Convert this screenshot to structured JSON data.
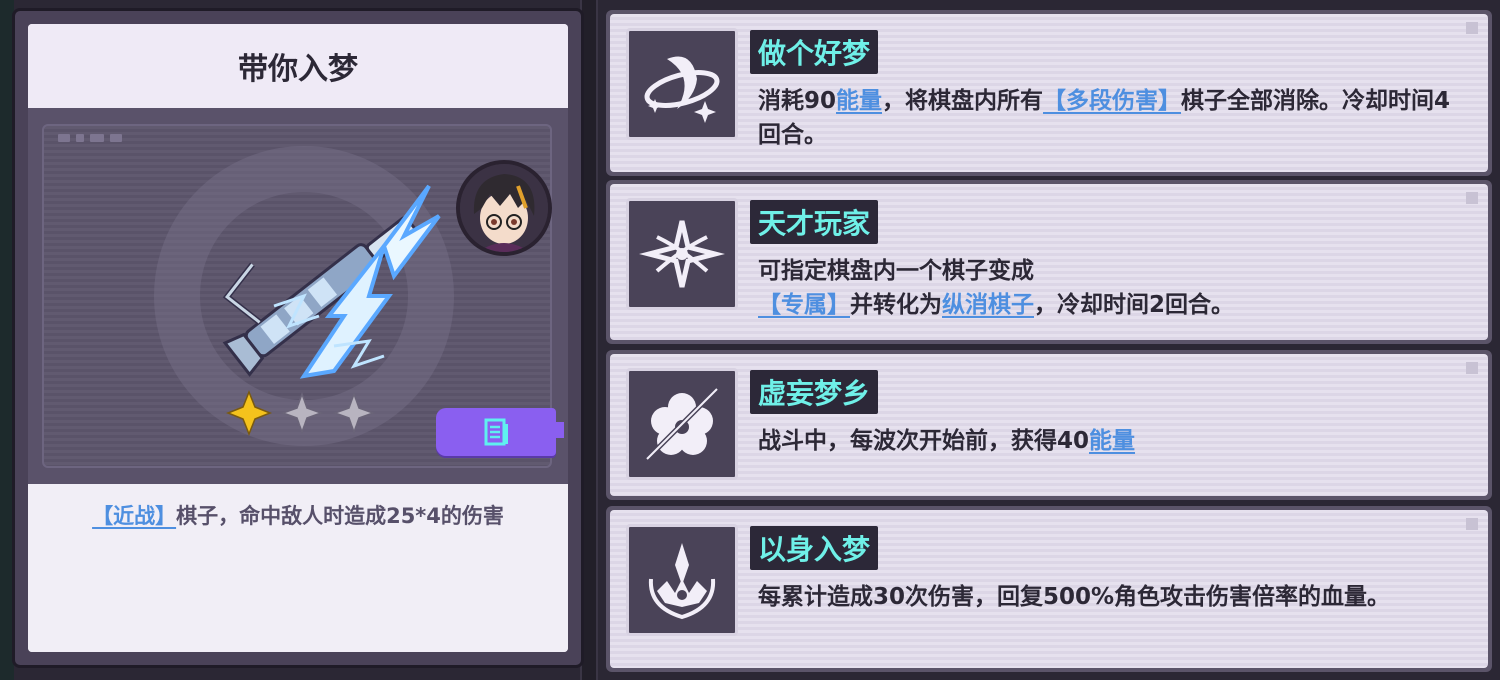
{
  "card": {
    "title": "带你入梦",
    "stars_filled": 1,
    "stars_total": 3,
    "desc": {
      "keyword": "【近战】",
      "text": "棋子，命中敌人时造成25*4的伤害"
    }
  },
  "skills": [
    {
      "name": "做个好梦",
      "icon": "ring-slash-icon",
      "desc": [
        {
          "t": "消耗90"
        },
        {
          "t": "能量",
          "kw": true
        },
        {
          "t": "，将棋盘内所有"
        },
        {
          "t": "【多段伤害】",
          "kw": true
        },
        {
          "t": "棋子全部消除。冷却时间4回合。"
        }
      ]
    },
    {
      "name": "天才玩家",
      "icon": "sparkle-orbit-icon",
      "desc": [
        {
          "t": "可指定棋盘内一个棋子变成"
        },
        {
          "t": "\n"
        },
        {
          "t": "【专属】",
          "kw": true
        },
        {
          "t": "并转化为"
        },
        {
          "t": "纵消棋子",
          "kw": true
        },
        {
          "t": "，冷却时间2回合。"
        }
      ]
    },
    {
      "name": "虚妄梦乡",
      "icon": "flower-icon",
      "desc": [
        {
          "t": "战斗中，每波次开始前，获得40"
        },
        {
          "t": "能量",
          "kw": true
        }
      ]
    },
    {
      "name": "以身入梦",
      "icon": "crown-emblem-icon",
      "desc": [
        {
          "t": "每累计造成30次伤害，回复500%角色攻击伤害倍率的血量。"
        }
      ]
    }
  ],
  "colors": {
    "keyword": "#4e8fe0",
    "skill_name": "#6ff0e8",
    "detail_button": "#8a5ff0",
    "star_gold": "#f4c21c",
    "star_gray": "#b8b4c0"
  }
}
